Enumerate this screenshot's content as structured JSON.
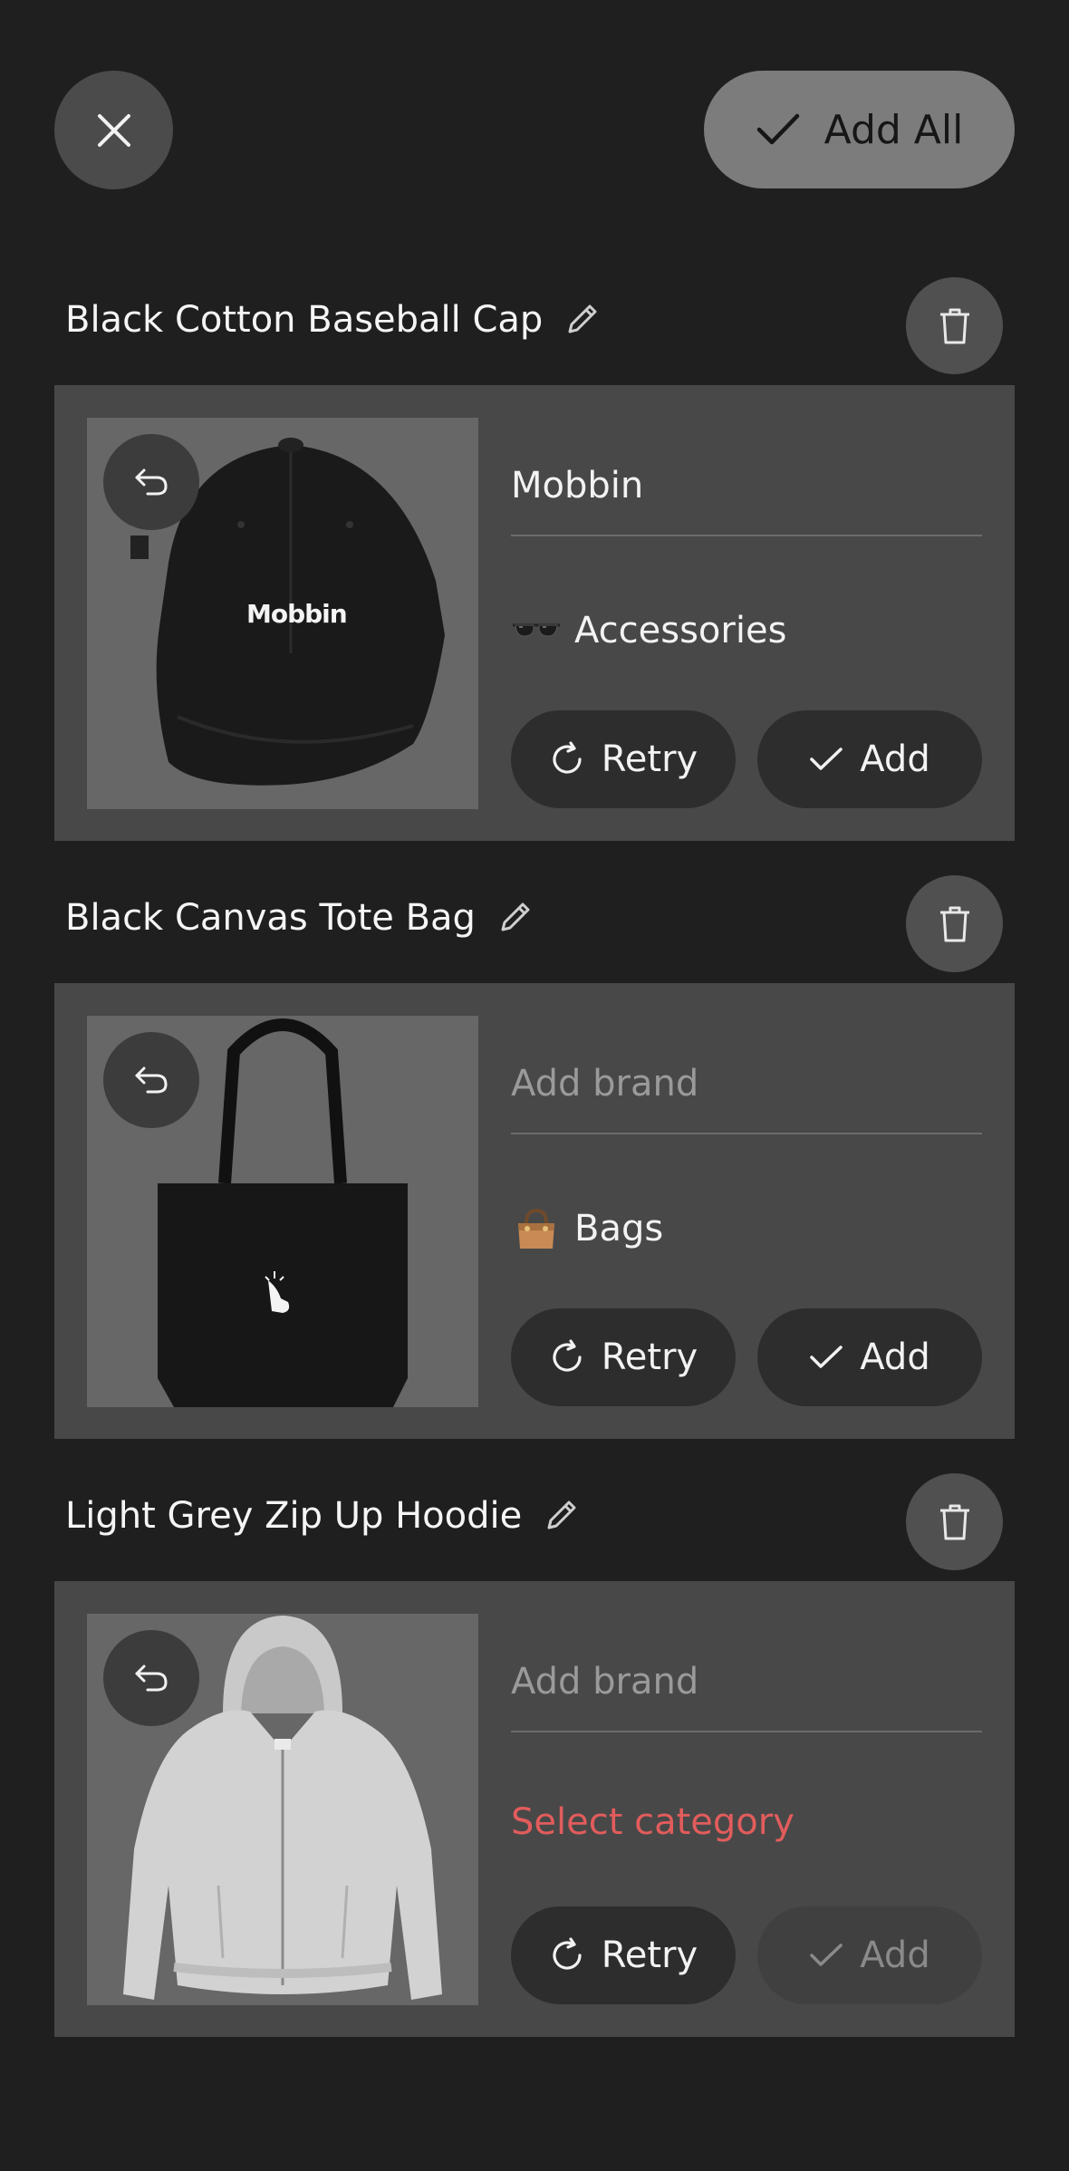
{
  "header": {
    "add_all_label": "Add All"
  },
  "items": [
    {
      "title": "Black Cotton Baseball Cap",
      "brand": "Mobbin",
      "brand_placeholder": "Add brand",
      "category": "Accessories",
      "category_icon": "sunglasses-icon",
      "product_print": "Mobbin",
      "retry_label": "Retry",
      "add_label": "Add",
      "add_enabled": true
    },
    {
      "title": "Black Canvas Tote Bag",
      "brand": "",
      "brand_placeholder": "Add brand",
      "category": "Bags",
      "category_icon": "handbag-icon",
      "retry_label": "Retry",
      "add_label": "Add",
      "add_enabled": true
    },
    {
      "title": "Light Grey Zip Up Hoodie",
      "brand": "",
      "brand_placeholder": "Add brand",
      "category": "Select category",
      "category_icon": "",
      "retry_label": "Retry",
      "add_label": "Add",
      "add_enabled": false
    }
  ],
  "colors": {
    "background": "#1f1f1f",
    "card": "#484848",
    "warning": "#e25c5c"
  }
}
